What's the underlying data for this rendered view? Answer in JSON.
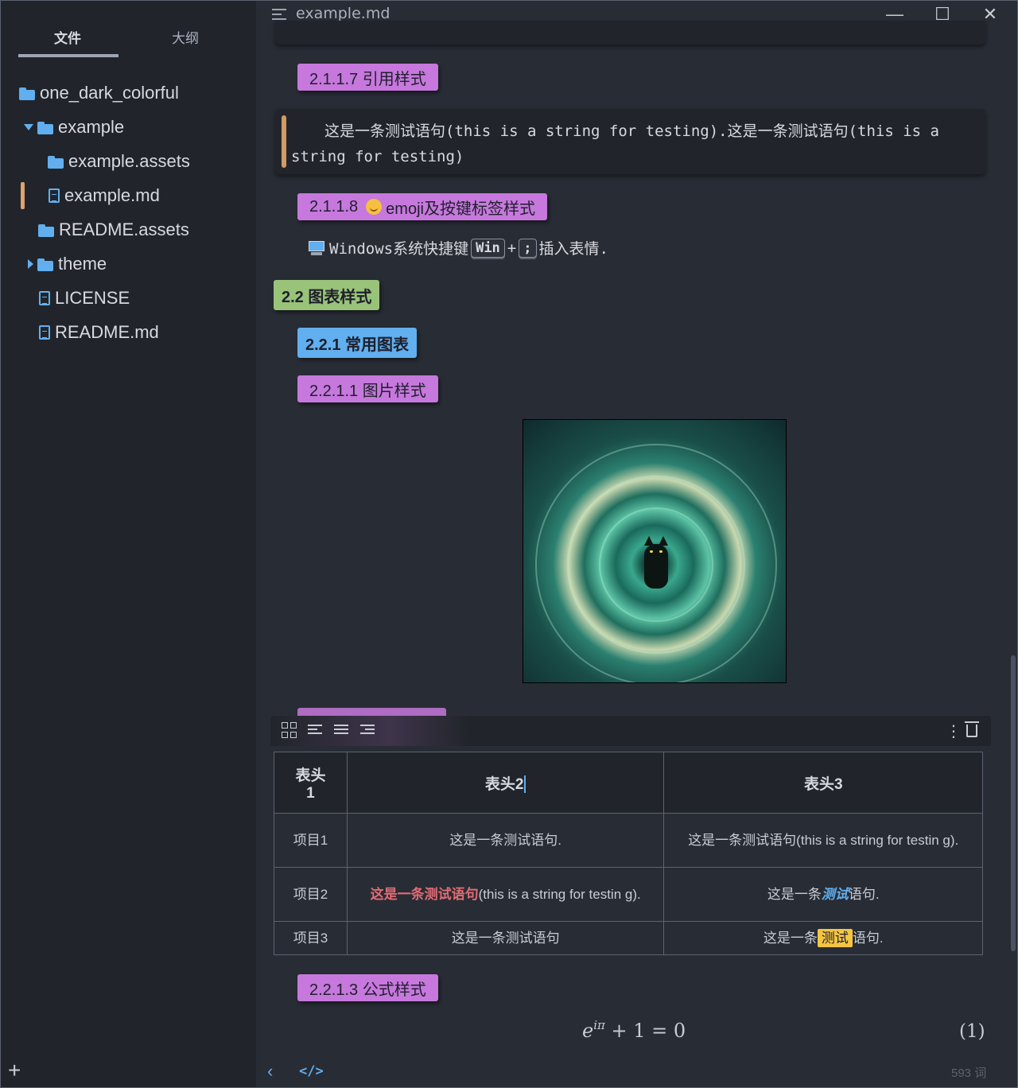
{
  "sidebar": {
    "tabs": [
      "文件",
      "大纲"
    ],
    "tree": [
      {
        "label": "one_dark_colorful",
        "type": "folder"
      },
      {
        "label": "example",
        "type": "folder"
      },
      {
        "label": "example.assets",
        "type": "folder"
      },
      {
        "label": "example.md",
        "type": "file"
      },
      {
        "label": "README.assets",
        "type": "folder"
      },
      {
        "label": "theme",
        "type": "folder"
      },
      {
        "label": "LICENSE",
        "type": "file"
      },
      {
        "label": "README.md",
        "type": "file"
      }
    ],
    "add_label": "+"
  },
  "titlebar": {
    "title": "example.md",
    "minimize": "—",
    "maximize": "☐",
    "close": "✕"
  },
  "content": {
    "h_quote": "2.1.1.7 引用样式",
    "quote_text": "这是一条测试语句(this is a string for testing).这是一条测试语句(this is a string for testing)",
    "h_emoji": "2.1.1.8",
    "h_emoji_rest": "emoji及按键标签样式",
    "emoji_line_prefix": "Windows系统快捷键",
    "kbd_win": "Win",
    "kbd_plus": "+",
    "kbd_semicolon": ";",
    "emoji_line_suffix": "插入表情.",
    "h2_charts": "2.2 图表样式",
    "h3_common": "2.2.1 常用图表",
    "h4_image": "2.2.1.1 图片样式",
    "h4_formula": "2.2.1.3 公式样式"
  },
  "table": {
    "headers": [
      "表头\n1",
      "表头2",
      "表头3"
    ],
    "rows": [
      {
        "c1": "项目1",
        "c2": "这是一条测试语句.",
        "c3": "这是一条测试语句(this is a string for testin g)."
      },
      {
        "c1": "项目2",
        "c2_red": "这是一条测试语句",
        "c2_rest": "(this is a string for testin g).",
        "c3_pre": "这是一条",
        "c3_em": "测试",
        "c3_post": "语句."
      },
      {
        "c1": "项目3",
        "c2": "这是一条测试语句",
        "c3_pre": "这是一条",
        "c3_hl": "测试",
        "c3_post": "语句."
      }
    ]
  },
  "formula": {
    "base": "e",
    "exponent": "iπ",
    "rest": "+ 1 = 0",
    "number": "(1)"
  },
  "status": {
    "back": "‹",
    "code": "</>",
    "word_count": "593 词"
  },
  "icons": {
    "folder": "folder-icon",
    "file": "file-icon",
    "computer": "computer-icon",
    "smile": "smiling-face-icon"
  },
  "colors": {
    "background": "#282c34",
    "sidebar": "#21252b",
    "accent_blue": "#61afef",
    "accent_purple": "#c678dd",
    "accent_green": "#98c379",
    "accent_orange": "#d19a66",
    "accent_red": "#e06c75",
    "highlight": "#f5c542"
  }
}
